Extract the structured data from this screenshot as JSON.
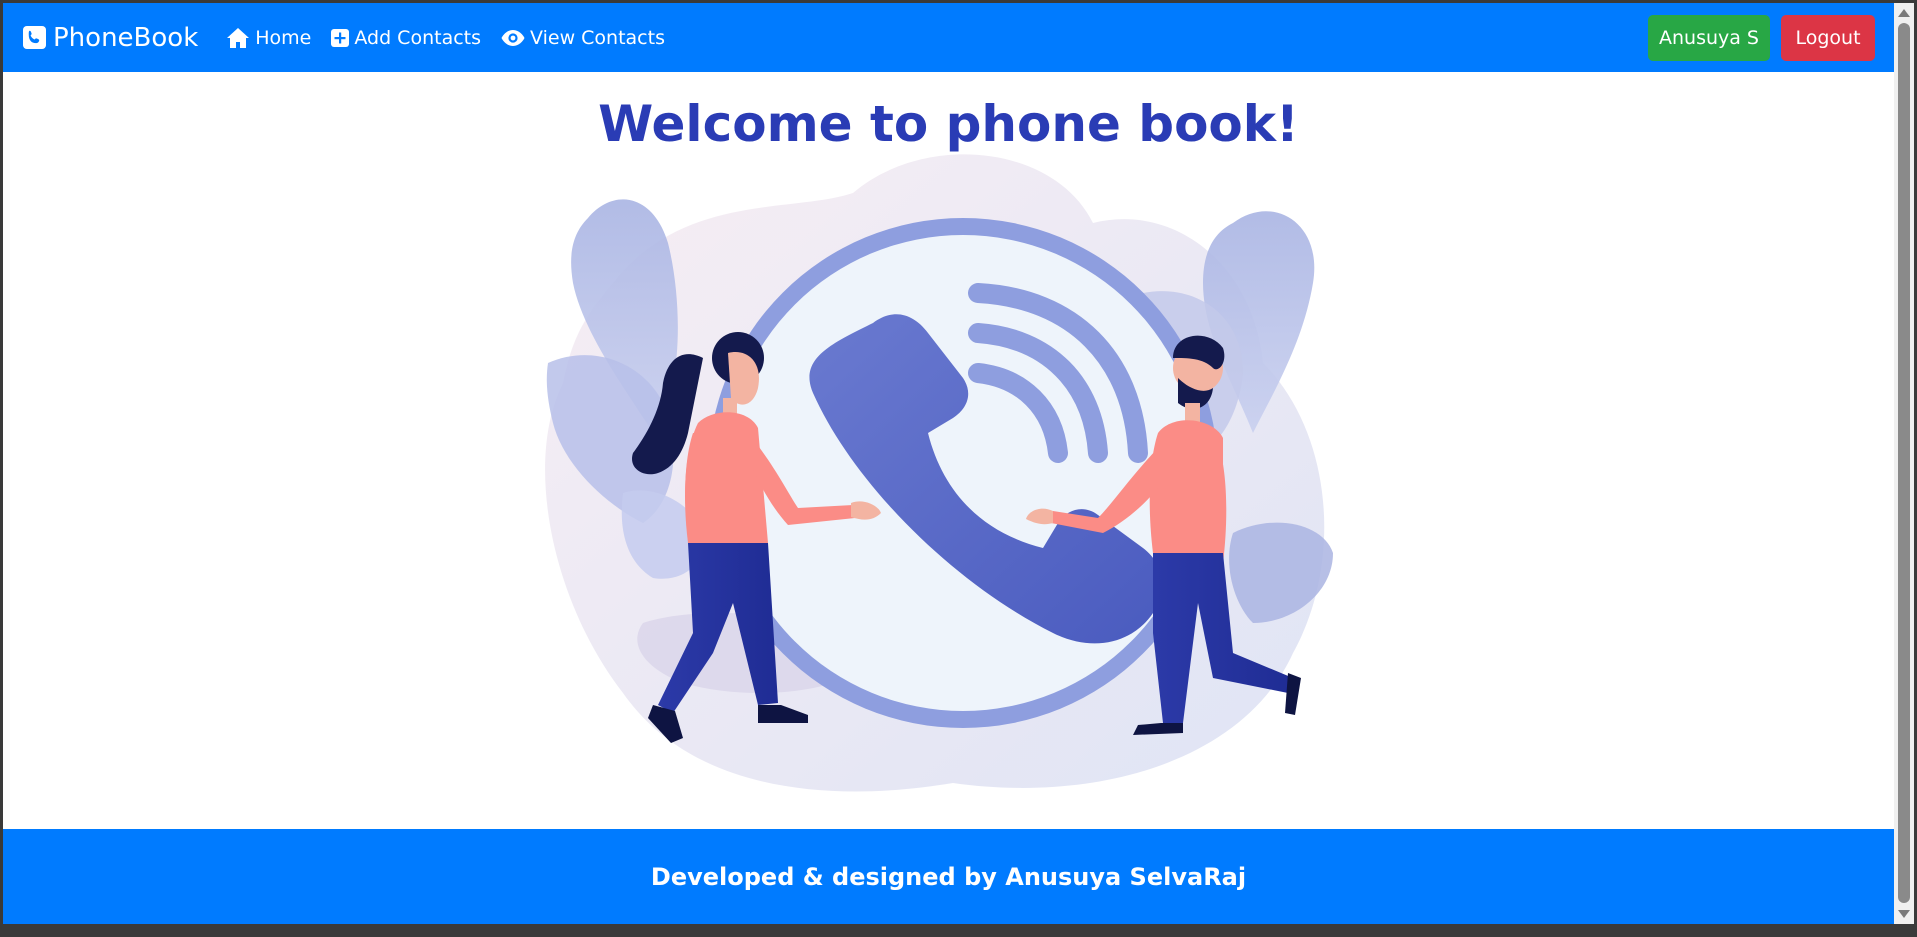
{
  "navbar": {
    "brand": "PhoneBook",
    "links": [
      {
        "label": "Home",
        "icon": "home-icon"
      },
      {
        "label": "Add Contacts",
        "icon": "plus-square-icon"
      },
      {
        "label": "View Contacts",
        "icon": "eye-icon"
      }
    ],
    "user_button": "Anusuya S",
    "logout_button": "Logout"
  },
  "main": {
    "title": "Welcome to phone book!",
    "illustration": "phone-call-illustration"
  },
  "footer": {
    "text": "Developed & designed by Anusuya SelvaRaj"
  },
  "colors": {
    "primary": "#007bff",
    "success": "#28a745",
    "danger": "#dc3545",
    "title": "#2a3cb5"
  }
}
